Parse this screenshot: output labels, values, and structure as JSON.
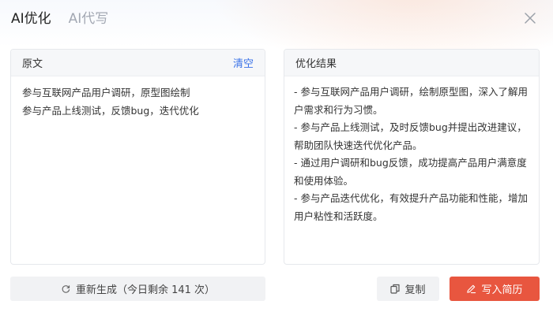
{
  "header": {
    "tabs": [
      {
        "label": "AI优化",
        "active": true
      },
      {
        "label": "AI代写",
        "active": false
      }
    ]
  },
  "original": {
    "title": "原文",
    "clear_label": "清空",
    "lines": [
      "参与互联网产品用户调研，原型图绘制",
      "参与产品上线测试，反馈bug，迭代优化"
    ]
  },
  "result": {
    "title": "优化结果",
    "text": "- 参与互联网产品用户调研，绘制原型图，深入了解用户需求和行为习惯。\n- 参与产品上线测试，及时反馈bug并提出改进建议，帮助团队快速迭代优化产品。\n- 通过用户调研和bug反馈，成功提高产品用户满意度和使用体验。\n- 参与产品迭代优化，有效提升产品功能和性能，增加用户粘性和活跃度。"
  },
  "actions": {
    "regenerate_label": "重新生成（今日剩余 141 次）",
    "copy_label": "复制",
    "write_label": "写入简历"
  },
  "icons": {
    "close": "close-icon",
    "regenerate": "refresh-icon",
    "copy": "copy-icon",
    "write": "pen-icon"
  },
  "colors": {
    "accent": "#e8563f",
    "link": "#3a72e8"
  }
}
